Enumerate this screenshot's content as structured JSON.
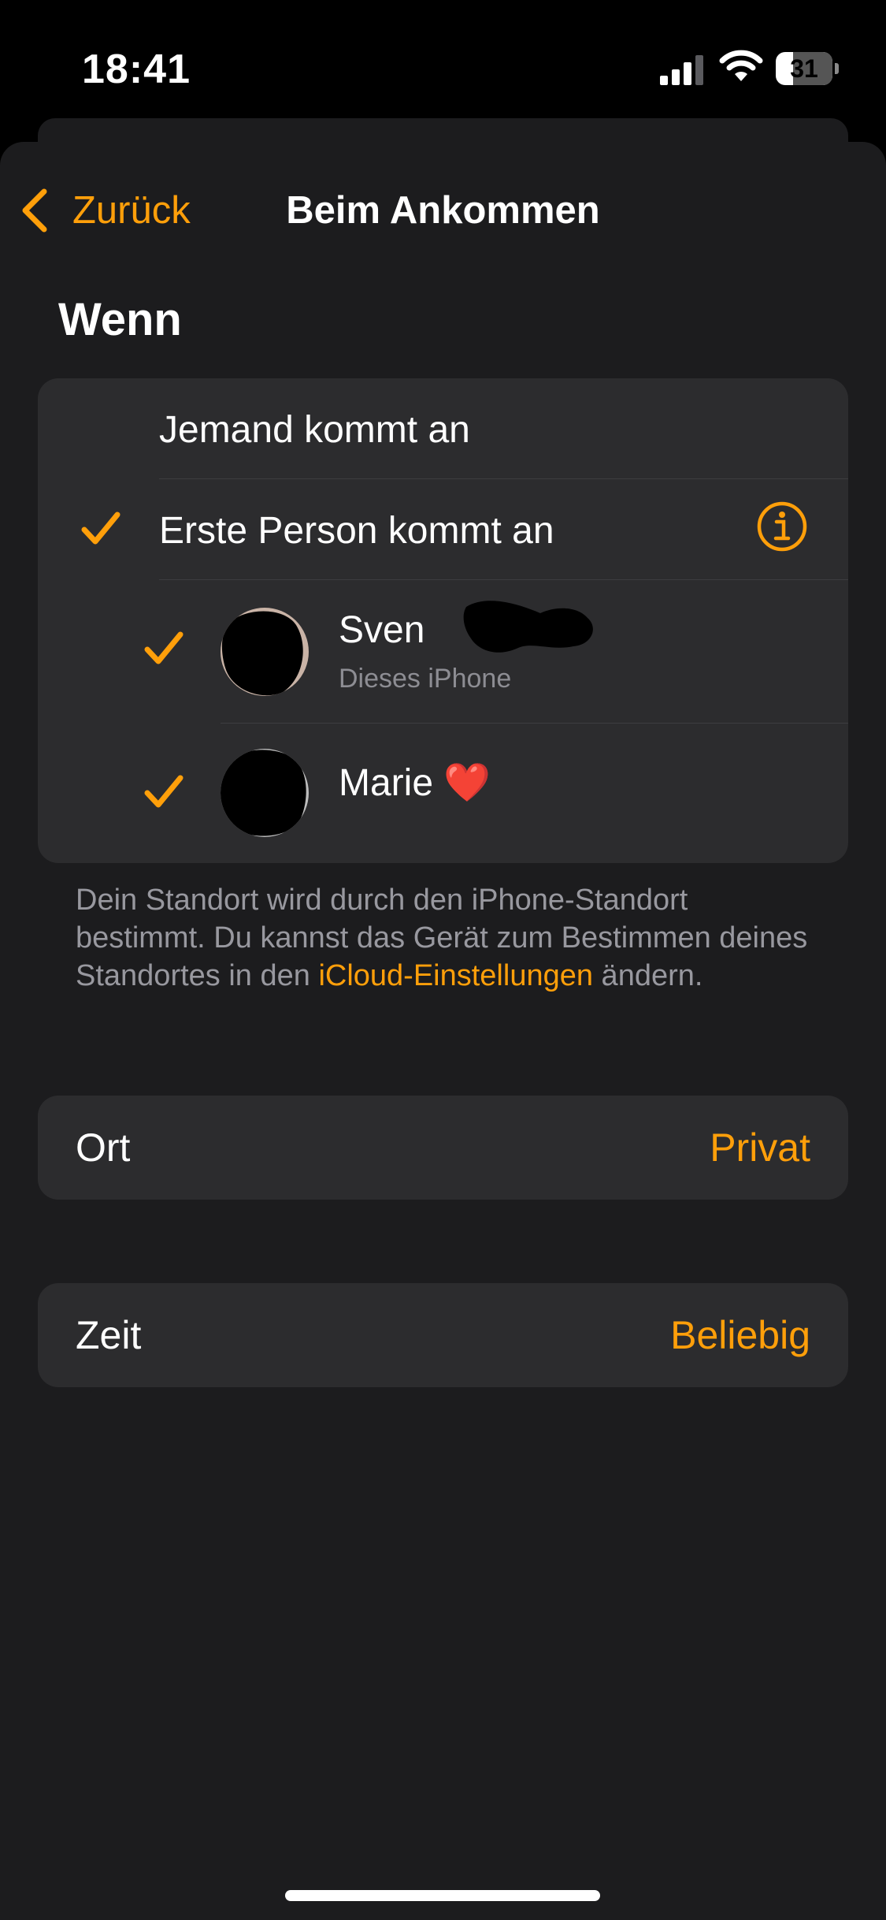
{
  "status_bar": {
    "time": "18:41",
    "battery_level": "31",
    "icons": [
      "signal-icon",
      "wifi-icon",
      "battery-icon"
    ]
  },
  "nav": {
    "back_label": "Zurück",
    "title": "Beim Ankommen"
  },
  "section": {
    "heading": "Wenn"
  },
  "options": [
    {
      "label": "Jemand kommt an",
      "checked": false
    },
    {
      "label": "Erste Person kommt an",
      "checked": true
    }
  ],
  "people": [
    {
      "name": "Sven",
      "subtitle": "Dieses iPhone",
      "checked": true
    },
    {
      "name": "Marie ❤️",
      "checked": true
    }
  ],
  "footer": {
    "text_before": "Dein Standort wird durch den iPhone-Standort bestimmt. Du kannst das Gerät zum Bestimmen deines Standortes in den ",
    "link": "iCloud-Einstellungen",
    "text_after": " ändern."
  },
  "location_row": {
    "label": "Ort",
    "value": "Privat"
  },
  "time_row": {
    "label": "Zeit",
    "value": "Beliebig"
  },
  "colors": {
    "accent": "#ff9f0a",
    "background": "#1c1c1e",
    "card": "#2c2c2e",
    "secondary_text": "#98989f"
  }
}
